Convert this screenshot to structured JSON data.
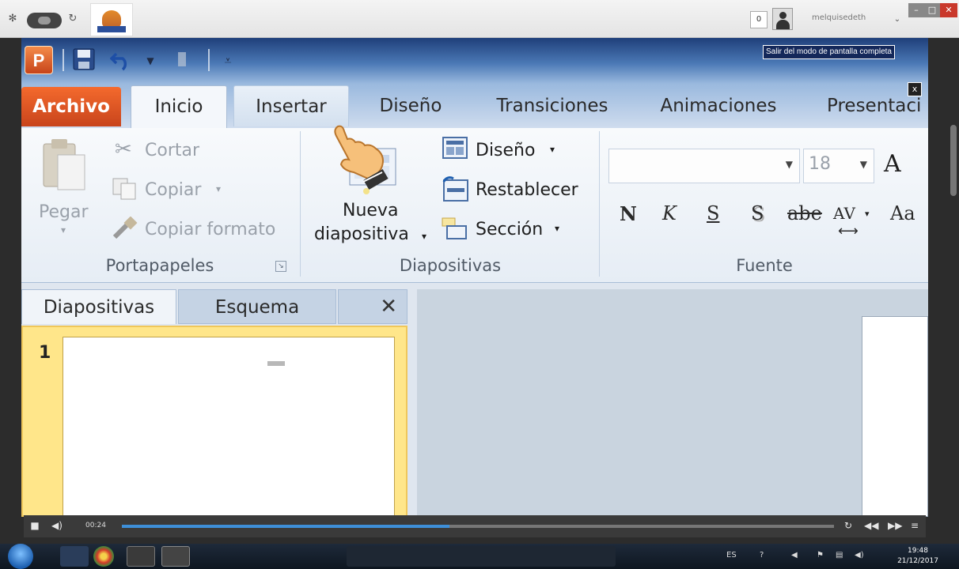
{
  "browser": {
    "unread_count": "0",
    "username": "melquisedeth"
  },
  "powerpoint": {
    "logo_letter": "P",
    "fullscreen_exit_label": "Salir del modo de pantalla completa",
    "fullscreen_close_label": "x",
    "tabs": [
      {
        "label": "Archivo"
      },
      {
        "label": "Inicio"
      },
      {
        "label": "Insertar"
      },
      {
        "label": "Diseño"
      },
      {
        "label": "Transiciones"
      },
      {
        "label": "Animaciones"
      },
      {
        "label": "Presentaci"
      }
    ],
    "ribbon": {
      "portapapeles": {
        "label": "Portapapeles",
        "paste": "Pegar",
        "cut": "Cortar",
        "copy": "Copiar",
        "format_painter": "Copiar formato"
      },
      "diapositivas": {
        "label": "Diapositivas",
        "new_slide_line1": "Nueva",
        "new_slide_line2": "diapositiva",
        "layout": "Diseño",
        "reset": "Restablecer",
        "section": "Sección"
      },
      "fuente": {
        "label": "Fuente",
        "font_name": "",
        "font_size": "18",
        "bold": "N",
        "italic": "K",
        "underline": "S",
        "shadow": "S",
        "strike": "abe",
        "spacing": "AV",
        "case": "Aa",
        "grow": "A"
      }
    },
    "panes": {
      "slides_tab": "Diapositivas",
      "outline_tab": "Esquema",
      "close": "✕",
      "slide_number": "1"
    }
  },
  "video": {
    "time": "00:24",
    "progress": 0.46
  },
  "taskbar": {
    "lang": "ES",
    "time": "19:48",
    "date": "21/12/2017"
  }
}
